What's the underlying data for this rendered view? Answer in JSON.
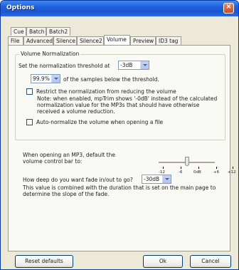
{
  "window": {
    "title": "Options",
    "close_glyph": "×"
  },
  "tabs_row1": [
    {
      "label": "Cue"
    },
    {
      "label": "Batch"
    },
    {
      "label": "Batch2"
    }
  ],
  "tabs_row2": [
    {
      "label": "File"
    },
    {
      "label": "Advanced"
    },
    {
      "label": "Silence"
    },
    {
      "label": "Silence2"
    },
    {
      "label": "Volume",
      "active": true
    },
    {
      "label": "Preview"
    },
    {
      "label": "ID3 tag"
    }
  ],
  "normalization": {
    "group_title": "Volume Normalization",
    "threshold_label": "Set the normalization threshold at",
    "threshold_value": "-3dB",
    "percent_value": "99.9%",
    "percent_suffix": "of the samples below the threshold.",
    "restrict_label": "Restrict the normalization from reducing the volume",
    "note_line1": "Note: when enabled, mpTrim shows '-0dB' instead of the calculated",
    "note_line2": "normalization value for the MP3s that should have otherwise",
    "note_line3": "received a volume reduction.",
    "auto_label": "Auto-normalize the volume when opening a file",
    "restrict_checked": false,
    "auto_checked": false
  },
  "volume_bar": {
    "label_line1": "When opening an MP3, default the",
    "label_line2": "volume control bar to:",
    "ticks": [
      "-12",
      "-6",
      "0dB",
      "+6",
      "+12"
    ],
    "value_db": 0
  },
  "fade": {
    "label": "How deep do you want fade in/out to go?",
    "value": "-30dB",
    "desc_line1": "This value is combined with the duration that is set on the main page to",
    "desc_line2": "determine the slope of the fade."
  },
  "buttons": {
    "reset": "Reset defaults",
    "ok": "Ok",
    "cancel": "Cancel"
  }
}
